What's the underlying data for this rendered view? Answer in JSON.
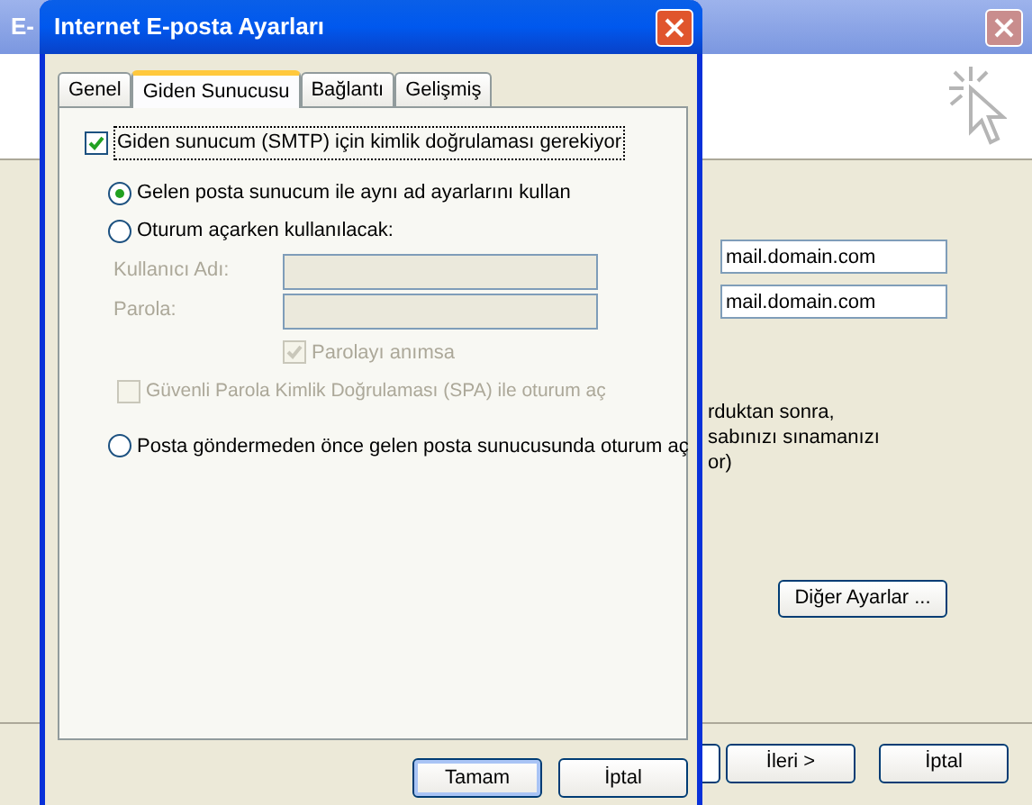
{
  "background_window": {
    "title": "E-",
    "fields": [
      {
        "value": "mail.domain.com"
      },
      {
        "value": "mail.domain.com"
      }
    ],
    "note_lines": [
      "rduktan sonra,",
      "sabınızı sınamanızı",
      "or)"
    ],
    "more_settings_button": "Diğer Ayarlar ...",
    "buttons": [
      "İleri >",
      "İptal"
    ]
  },
  "dialog": {
    "title": "Internet E-posta Ayarları",
    "tabs": [
      {
        "label": "Genel",
        "selected": false
      },
      {
        "label": "Giden Sunucusu",
        "selected": true
      },
      {
        "label": "Bağlantı",
        "selected": false
      },
      {
        "label": "Gelişmiş",
        "selected": false
      }
    ],
    "require_auth": {
      "label": "Giden sunucum (SMTP) için kimlik doğrulaması gerekiyor",
      "checked": true
    },
    "radios": [
      {
        "label": "Gelen posta sunucum ile aynı ad ayarlarını kullan",
        "selected": true
      },
      {
        "label": "Oturum açarken kullanılacak:",
        "selected": false
      },
      {
        "label": "Posta göndermeden önce gelen posta sunucusunda oturum aç",
        "selected": false
      }
    ],
    "login": {
      "disabled": true,
      "user_label": "Kullanıcı Adı:",
      "password_label": "Parola:",
      "remember": {
        "label": "Parolayı anımsa",
        "checked": true
      },
      "spa": {
        "label": "Güvenli Parola Kimlik Doğrulaması (SPA) ile oturum aç",
        "checked": false
      }
    },
    "buttons": [
      {
        "label": "Tamam",
        "default": true
      },
      {
        "label": "İptal",
        "default": false
      }
    ]
  }
}
